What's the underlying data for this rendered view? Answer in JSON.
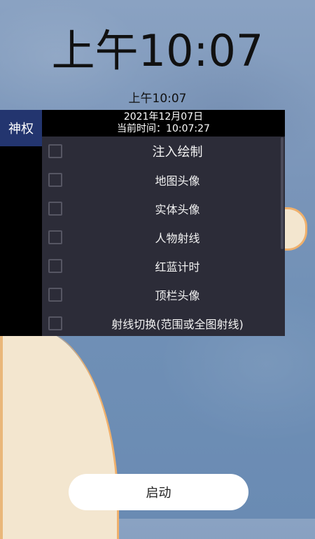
{
  "lockscreen": {
    "big_time": "上午10:07",
    "small_time": "上午10:07"
  },
  "sidebar": {
    "tab_label": "神权"
  },
  "panel": {
    "date_line": "2021年12月07日",
    "time_line": "当前时间：10:07:27",
    "items": [
      {
        "label": "注入绘制",
        "checked": false
      },
      {
        "label": "地图头像",
        "checked": false
      },
      {
        "label": "实体头像",
        "checked": false
      },
      {
        "label": "人物射线",
        "checked": false
      },
      {
        "label": "红蓝计时",
        "checked": false
      },
      {
        "label": "顶栏头像",
        "checked": false
      },
      {
        "label": "射线切换(范围或全图射线)",
        "checked": false
      }
    ]
  },
  "footer": {
    "launch_label": "启动"
  },
  "colors": {
    "panel_bg": "#2c2c38",
    "sidebar_tab": "#23356f",
    "header_bg": "#000000"
  }
}
